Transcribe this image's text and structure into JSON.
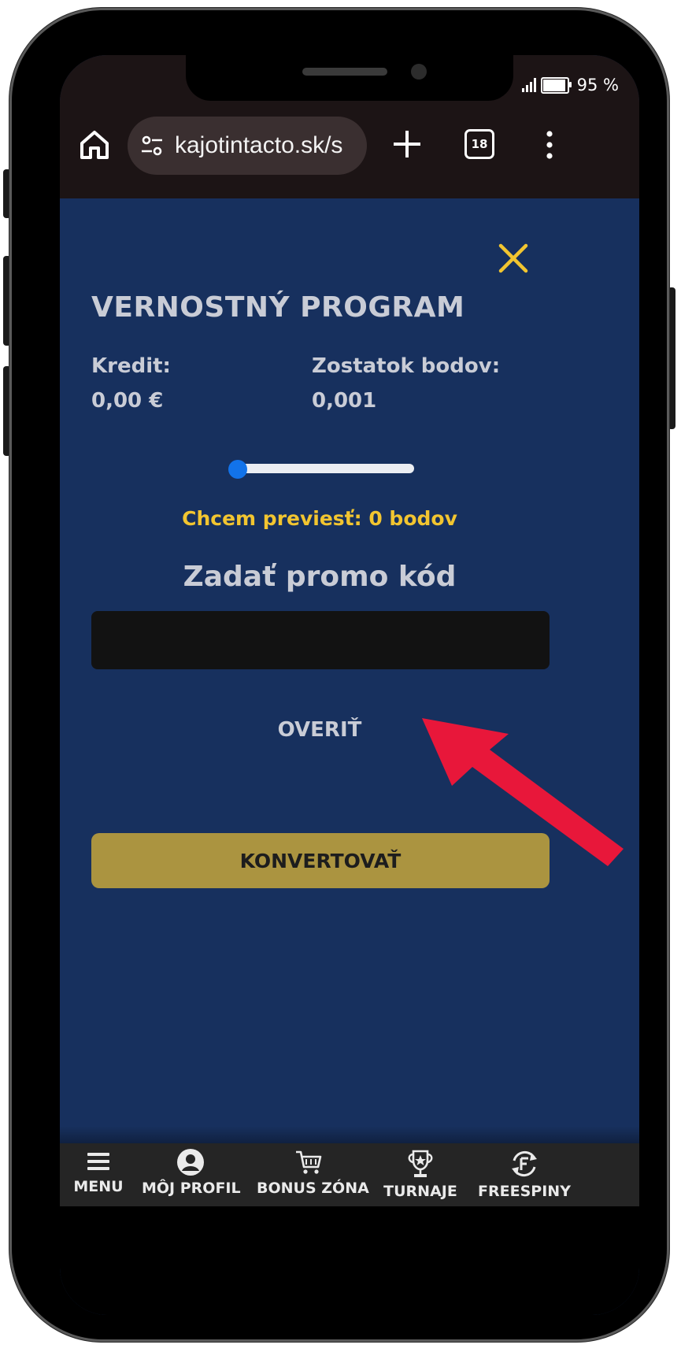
{
  "status_bar": {
    "battery": "95 %"
  },
  "browser": {
    "url": "kajotintacto.sk/s",
    "tab_count": "18",
    "icons": [
      "home-icon",
      "site-settings-icon",
      "plus-icon",
      "tabs-icon",
      "more-vert-icon"
    ]
  },
  "modal": {
    "title": "VERNOSTNÝ PROGRAM",
    "credit_label": "Kredit:",
    "credit_value": "0,00 €",
    "points_label": "Zostatok bodov:",
    "points_value": "0,001",
    "slider_value": 0,
    "transfer_text": "Chcem previesť: 0 bodov",
    "promo_heading": "Zadať promo kód",
    "promo_value": "",
    "verify_label": "OVERIŤ",
    "convert_label": "KONVERTOVAŤ"
  },
  "bottom_nav": {
    "items": [
      {
        "label": "MENU",
        "icon": "menu-icon"
      },
      {
        "label": "MÔJ PROFIL",
        "icon": "profile-icon"
      },
      {
        "label": "BONUS ZÓNA",
        "icon": "cart-icon"
      },
      {
        "label": "TURNAJE",
        "icon": "trophy-icon"
      },
      {
        "label": "FREESPINY",
        "icon": "freespin-icon"
      }
    ]
  },
  "colors": {
    "modal_background": "#17305e",
    "accent_yellow": "#f2c530",
    "convert_button": "#ab9440",
    "slider_thumb": "#1273ea",
    "annotation_arrow": "#e8173a"
  }
}
